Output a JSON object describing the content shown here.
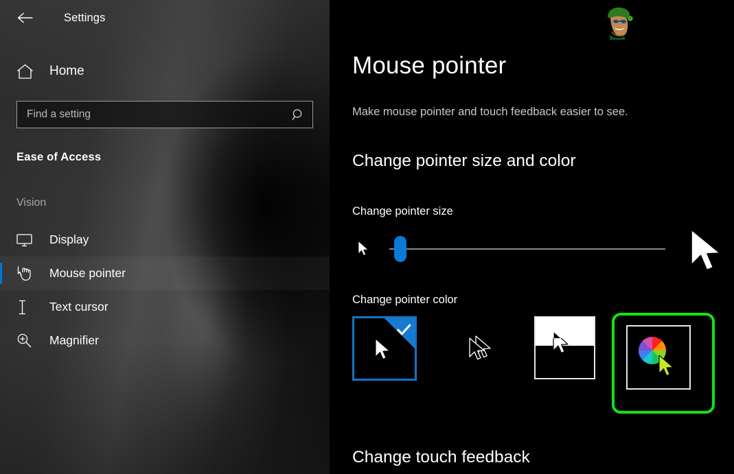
{
  "window": {
    "app_title": "Settings",
    "back_icon": "back-arrow-icon"
  },
  "sidebar": {
    "home": {
      "label": "Home",
      "icon": "home-icon"
    },
    "search": {
      "value": "",
      "placeholder": "Find a setting",
      "icon": "search-icon"
    },
    "category_title": "Ease of Access",
    "group_label": "Vision",
    "items": [
      {
        "label": "Display",
        "icon": "monitor-icon",
        "selected": false
      },
      {
        "label": "Mouse pointer",
        "icon": "mouse-pointer-hand-icon",
        "selected": true
      },
      {
        "label": "Text cursor",
        "icon": "text-cursor-icon",
        "selected": false
      },
      {
        "label": "Magnifier",
        "icon": "magnifier-icon",
        "selected": false
      }
    ],
    "accent_color": "#0078d7"
  },
  "main": {
    "title": "Mouse pointer",
    "subtitle": "Make mouse pointer and touch feedback easier to see.",
    "section_size_color": "Change pointer size and color",
    "pointer_size": {
      "label": "Change pointer size",
      "value": 1,
      "min": 1,
      "max": 15,
      "thumb_percent": 4,
      "left_icon": "small-pointer-icon",
      "right_icon": "large-pointer-icon",
      "thumb_color": "#0a7ad6",
      "track_color": "#8a8a8a"
    },
    "pointer_color": {
      "label": "Change pointer color",
      "options": [
        {
          "name": "white-pointer",
          "selected": true,
          "checkmark": true,
          "border_color": "#1475c4"
        },
        {
          "name": "black-pointer",
          "selected": false,
          "checkmark": false,
          "border_color": ""
        },
        {
          "name": "inverted-pointer",
          "selected": false,
          "checkmark": false,
          "border_color": "#e6e6e6"
        },
        {
          "name": "custom-color-pointer",
          "selected": false,
          "checkmark": false,
          "border_color": "#e6e6e6"
        }
      ],
      "highlight": {
        "target": "custom-color-pointer",
        "color": "#12e316"
      }
    },
    "section_touch_feedback": "Change touch feedback",
    "avatar": "user-avatar-icon"
  }
}
